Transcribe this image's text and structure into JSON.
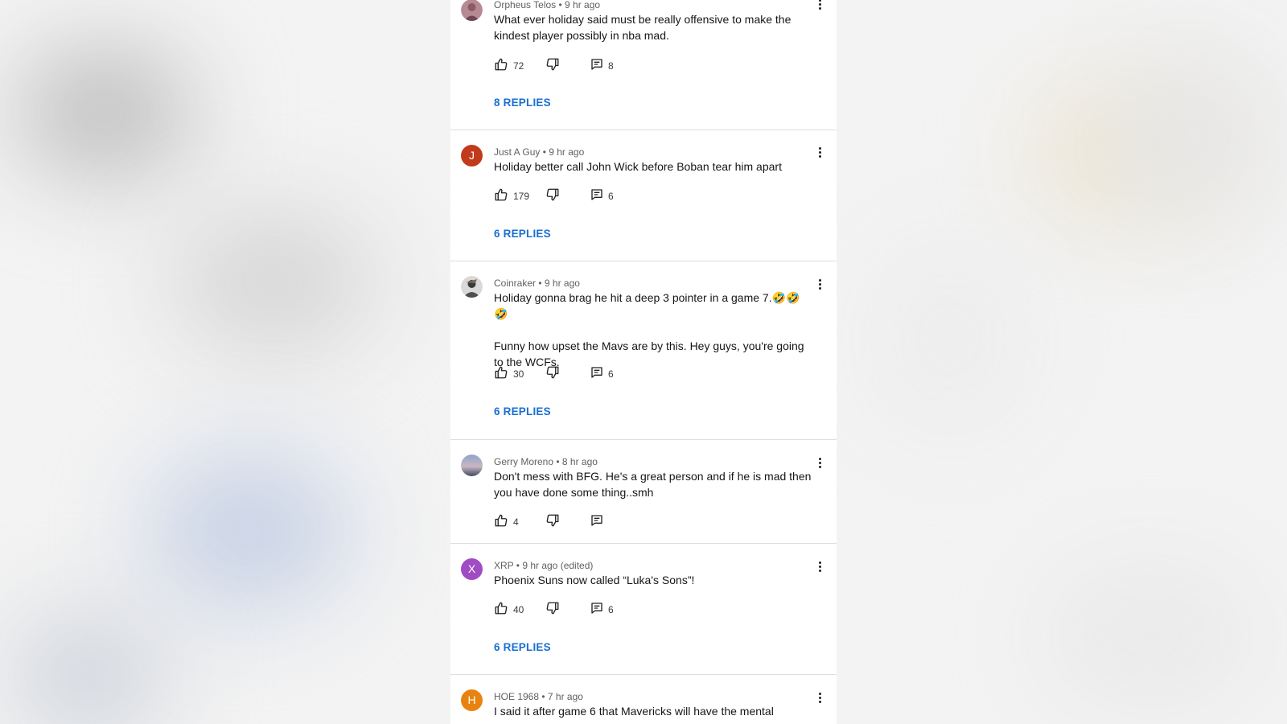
{
  "comments": [
    {
      "author": "Orpheus Telos",
      "meta": "Orpheus Telos • 9 hr ago",
      "avatar_letter": "",
      "avatar_color": "#b78a93",
      "paragraphs": [
        "What ever holiday said must be really offensive to make the kindest player possibly in nba mad."
      ],
      "likes": "72",
      "reply_count": "8",
      "replies_label": "8 REPLIES"
    },
    {
      "author": "Just A Guy",
      "meta": "Just A Guy • 9 hr ago",
      "avatar_letter": "J",
      "avatar_color": "#c23a1c",
      "paragraphs": [
        "Holiday better call John Wick before Boban tear him apart"
      ],
      "likes": "179",
      "reply_count": "6",
      "replies_label": "6 REPLIES"
    },
    {
      "author": "Coinraker",
      "meta": "Coinraker • 9 hr ago",
      "avatar_letter": "",
      "avatar_color": "#5a5a5a",
      "paragraphs": [
        "Holiday gonna brag he hit a deep 3 pointer in a game 7.🤣🤣🤣",
        "Funny how upset the Mavs are by this. Hey guys, you're going to the WCFs."
      ],
      "likes": "30",
      "reply_count": "6",
      "replies_label": "6 REPLIES"
    },
    {
      "author": "Gerry Moreno",
      "meta": "Gerry Moreno • 8 hr ago",
      "avatar_letter": "",
      "avatar_color": "#6f7fa3",
      "paragraphs": [
        "Don't mess with BFG. He's a great person and if he is mad then you have done some thing..smh"
      ],
      "likes": "4",
      "reply_count": "",
      "replies_label": ""
    },
    {
      "author": "XRP",
      "meta": "XRP • 9 hr ago (edited)",
      "avatar_letter": "X",
      "avatar_color": "#a04cc4",
      "paragraphs": [
        "Phoenix Suns now called “Luka's Sons”!"
      ],
      "likes": "40",
      "reply_count": "6",
      "replies_label": "6 REPLIES"
    },
    {
      "author": "HOE 1968",
      "meta": "HOE 1968 • 7 hr ago",
      "avatar_letter": "H",
      "avatar_color": "#e8830f",
      "paragraphs": [
        "I said it after game 6 that Mavericks will have the mental"
      ],
      "likes": "",
      "reply_count": "",
      "replies_label": ""
    }
  ]
}
